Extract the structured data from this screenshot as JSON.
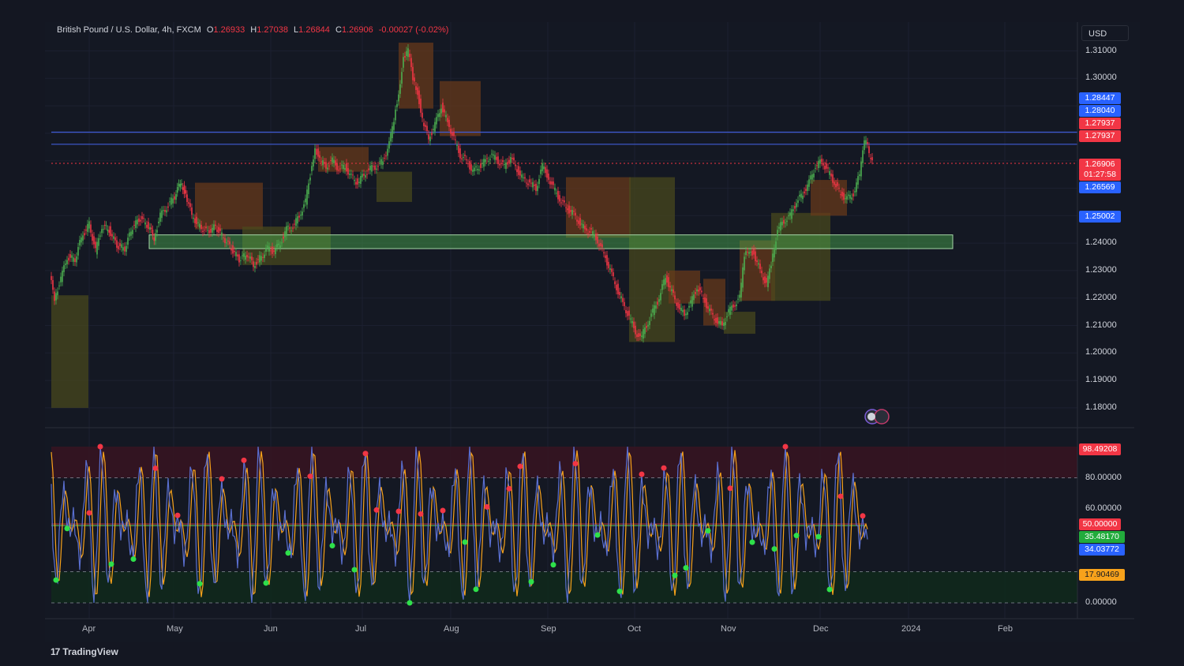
{
  "header": {
    "symbol": "British Pound / U.S. Dollar, 4h, FXCM",
    "o_key": "O",
    "o_val": "1.26933",
    "h_key": "H",
    "h_val": "1.27038",
    "l_key": "L",
    "l_val": "1.26844",
    "c_key": "C",
    "c_val": "1.26906",
    "change": "-0.00027 (-0.02%)"
  },
  "currency_label": "USD",
  "brand": "TradingView",
  "price_axis_labels": [
    "1.31000",
    "1.30000",
    "1.24000",
    "1.23000",
    "1.22000",
    "1.21000",
    "1.20000",
    "1.19000",
    "1.18000"
  ],
  "price_badges": [
    {
      "text": "1.28447",
      "color": "#2962ff"
    },
    {
      "text": "1.28040",
      "color": "#2962ff"
    },
    {
      "text": "1.27937",
      "color": "#f23645"
    },
    {
      "text": "1.27937",
      "color": "#f23645"
    },
    {
      "text": "1.26906",
      "color": "#f23645"
    },
    {
      "text": "01:27:58",
      "color": "#f23645"
    },
    {
      "text": "1.26569",
      "color": "#2962ff"
    },
    {
      "text": "1.25002",
      "color": "#2962ff"
    }
  ],
  "osc_axis_labels": [
    "80.00000",
    "60.00000",
    "0.00000"
  ],
  "osc_badges": [
    {
      "text": "98.49208",
      "color": "#f23645",
      "fg": "#ffffff"
    },
    {
      "text": "50.00000",
      "color": "#f23645",
      "fg": "#ffffff"
    },
    {
      "text": "35.48170",
      "color": "#22ab3c",
      "fg": "#ffffff"
    },
    {
      "text": "34.03772",
      "color": "#2962ff",
      "fg": "#ffffff"
    },
    {
      "text": "17.90469",
      "color": "#f7a21b",
      "fg": "#141823"
    }
  ],
  "x_labels": [
    "Apr",
    "May",
    "Jun",
    "Jul",
    "Aug",
    "Sep",
    "Oct",
    "Nov",
    "Dec",
    "2024",
    "Feb"
  ],
  "colors": {
    "up": "#26a69a",
    "down": "#ef5350",
    "candle_up": "#4caf50",
    "candle_down": "#f23645",
    "blue_line": "#3f5bd6",
    "zone_green": "#2e7d32",
    "osc_blue": "#5a6fd0",
    "osc_orange": "#f7a21b",
    "dot_red": "#f23645",
    "dot_green": "#2ee04a"
  },
  "chart_data": [
    {
      "type": "line",
      "title": "British Pound / U.S. Dollar, 4h, FXCM",
      "xlabel": "",
      "ylabel": "",
      "x": [
        "Apr",
        "May",
        "Jun",
        "Jul",
        "Aug",
        "Sep",
        "Oct",
        "Nov",
        "Dec"
      ],
      "series": [
        {
          "values": [
            1.225,
            1.248,
            1.242,
            1.27,
            1.282,
            1.265,
            1.206,
            1.231,
            1.272
          ]
        }
      ],
      "path_points": [
        [
          0,
          1.228
        ],
        [
          6,
          1.22
        ],
        [
          14,
          1.227
        ],
        [
          22,
          1.235
        ],
        [
          32,
          1.234
        ],
        [
          40,
          1.242
        ],
        [
          50,
          1.247
        ],
        [
          58,
          1.237
        ],
        [
          66,
          1.246
        ],
        [
          75,
          1.245
        ],
        [
          85,
          1.239
        ],
        [
          95,
          1.238
        ],
        [
          105,
          1.246
        ],
        [
          115,
          1.249
        ],
        [
          125,
          1.246
        ],
        [
          132,
          1.242
        ],
        [
          140,
          1.25
        ],
        [
          148,
          1.253
        ],
        [
          158,
          1.257
        ],
        [
          165,
          1.262
        ],
        [
          172,
          1.258
        ],
        [
          180,
          1.25
        ],
        [
          190,
          1.246
        ],
        [
          200,
          1.244
        ],
        [
          210,
          1.246
        ],
        [
          220,
          1.242
        ],
        [
          230,
          1.238
        ],
        [
          240,
          1.234
        ],
        [
          250,
          1.236
        ],
        [
          258,
          1.232
        ],
        [
          268,
          1.235
        ],
        [
          276,
          1.238
        ],
        [
          284,
          1.237
        ],
        [
          292,
          1.24
        ],
        [
          300,
          1.245
        ],
        [
          308,
          1.246
        ],
        [
          316,
          1.25
        ],
        [
          324,
          1.255
        ],
        [
          330,
          1.265
        ],
        [
          336,
          1.275
        ],
        [
          342,
          1.27
        ],
        [
          350,
          1.268
        ],
        [
          358,
          1.27
        ],
        [
          366,
          1.267
        ],
        [
          374,
          1.268
        ],
        [
          382,
          1.264
        ],
        [
          390,
          1.262
        ],
        [
          398,
          1.265
        ],
        [
          406,
          1.267
        ],
        [
          414,
          1.268
        ],
        [
          422,
          1.27
        ],
        [
          430,
          1.276
        ],
        [
          436,
          1.285
        ],
        [
          442,
          1.295
        ],
        [
          448,
          1.307
        ],
        [
          454,
          1.31
        ],
        [
          460,
          1.3
        ],
        [
          466,
          1.295
        ],
        [
          472,
          1.285
        ],
        [
          480,
          1.278
        ],
        [
          488,
          1.283
        ],
        [
          496,
          1.29
        ],
        [
          504,
          1.284
        ],
        [
          512,
          1.278
        ],
        [
          520,
          1.272
        ],
        [
          528,
          1.27
        ],
        [
          536,
          1.266
        ],
        [
          544,
          1.268
        ],
        [
          552,
          1.27
        ],
        [
          560,
          1.272
        ],
        [
          568,
          1.27
        ],
        [
          576,
          1.268
        ],
        [
          584,
          1.271
        ],
        [
          592,
          1.267
        ],
        [
          600,
          1.263
        ],
        [
          608,
          1.262
        ],
        [
          616,
          1.26
        ],
        [
          624,
          1.268
        ],
        [
          630,
          1.265
        ],
        [
          638,
          1.26
        ],
        [
          646,
          1.256
        ],
        [
          654,
          1.253
        ],
        [
          662,
          1.251
        ],
        [
          670,
          1.248
        ],
        [
          678,
          1.245
        ],
        [
          686,
          1.244
        ],
        [
          694,
          1.241
        ],
        [
          702,
          1.236
        ],
        [
          710,
          1.23
        ],
        [
          718,
          1.224
        ],
        [
          726,
          1.218
        ],
        [
          734,
          1.213
        ],
        [
          742,
          1.208
        ],
        [
          748,
          1.205
        ],
        [
          756,
          1.21
        ],
        [
          764,
          1.215
        ],
        [
          772,
          1.22
        ],
        [
          780,
          1.228
        ],
        [
          788,
          1.222
        ],
        [
          796,
          1.217
        ],
        [
          804,
          1.214
        ],
        [
          812,
          1.218
        ],
        [
          820,
          1.224
        ],
        [
          828,
          1.22
        ],
        [
          836,
          1.215
        ],
        [
          844,
          1.212
        ],
        [
          852,
          1.21
        ],
        [
          860,
          1.215
        ],
        [
          868,
          1.218
        ],
        [
          874,
          1.22
        ],
        [
          880,
          1.235
        ],
        [
          886,
          1.238
        ],
        [
          892,
          1.236
        ],
        [
          900,
          1.23
        ],
        [
          908,
          1.225
        ],
        [
          914,
          1.232
        ],
        [
          922,
          1.245
        ],
        [
          930,
          1.248
        ],
        [
          938,
          1.25
        ],
        [
          946,
          1.255
        ],
        [
          954,
          1.258
        ],
        [
          962,
          1.262
        ],
        [
          970,
          1.268
        ],
        [
          978,
          1.27
        ],
        [
          986,
          1.266
        ],
        [
          994,
          1.262
        ],
        [
          1002,
          1.258
        ],
        [
          1010,
          1.256
        ],
        [
          1018,
          1.258
        ],
        [
          1026,
          1.265
        ],
        [
          1030,
          1.275
        ],
        [
          1034,
          1.278
        ],
        [
          1038,
          1.272
        ],
        [
          1042,
          1.269
        ]
      ],
      "resistance_lines": [
        1.2804,
        1.276
      ],
      "current_price_line": 1.26906,
      "support_zone": {
        "low": 1.238,
        "high": 1.243,
        "x_start": "May",
        "x_end": "2024"
      }
    },
    {
      "type": "line",
      "title": "",
      "ylim": [
        0,
        100
      ],
      "levels": [
        80,
        50,
        20,
        0
      ],
      "series": [
        {
          "values": [
            98.49208,
            35.4817,
            17.90469
          ]
        }
      ]
    }
  ]
}
